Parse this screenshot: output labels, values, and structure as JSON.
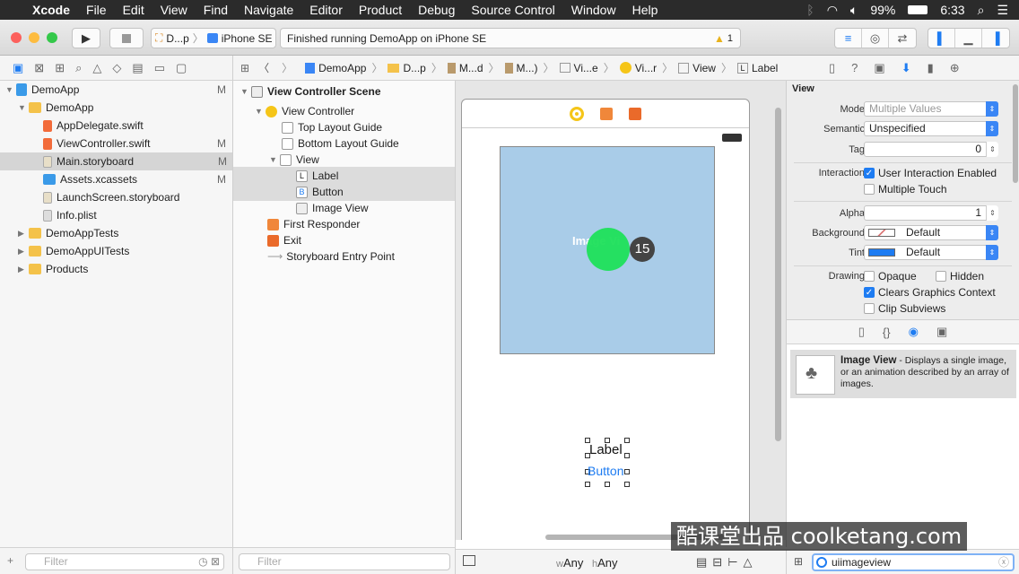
{
  "menubar": {
    "app_name": "Xcode",
    "items": [
      "File",
      "Edit",
      "View",
      "Find",
      "Navigate",
      "Editor",
      "Product",
      "Debug",
      "Source Control",
      "Window",
      "Help"
    ],
    "battery": "99%",
    "time": "6:33"
  },
  "toolbar": {
    "scheme_target": "D...p",
    "device": "iPhone SE",
    "activity_status": "Finished running DemoApp on iPhone SE",
    "warning_count": "1"
  },
  "navigator": {
    "items": [
      {
        "label": "DemoApp",
        "badge": "M"
      },
      {
        "label": "DemoApp",
        "badge": ""
      },
      {
        "label": "AppDelegate.swift",
        "badge": ""
      },
      {
        "label": "ViewController.swift",
        "badge": "M"
      },
      {
        "label": "Main.storyboard",
        "badge": "M"
      },
      {
        "label": "Assets.xcassets",
        "badge": "M"
      },
      {
        "label": "LaunchScreen.storyboard",
        "badge": ""
      },
      {
        "label": "Info.plist",
        "badge": ""
      },
      {
        "label": "DemoAppTests",
        "badge": ""
      },
      {
        "label": "DemoAppUITests",
        "badge": ""
      },
      {
        "label": "Products",
        "badge": ""
      }
    ],
    "filter_placeholder": "Filter"
  },
  "jumpbar": {
    "crumbs": [
      "DemoApp",
      "D...p",
      "M...d",
      "M...)",
      "Vi...e",
      "Vi...r",
      "View",
      "Label"
    ]
  },
  "outline": {
    "title": "View Controller Scene",
    "items": [
      "View Controller",
      "Top Layout Guide",
      "Bottom Layout Guide",
      "View",
      "Label",
      "Button",
      "Image View",
      "First Responder",
      "Exit",
      "Storyboard Entry Point"
    ],
    "filter_placeholder": "Filter"
  },
  "canvas": {
    "image_view_text": "Image Vi",
    "badge_number": "15",
    "label_text": "Label",
    "button_text": "Button",
    "size_w_prefix": "w",
    "size_w": "Any",
    "size_h_prefix": "h",
    "size_h": "Any"
  },
  "inspector": {
    "section": "View",
    "mode_label": "Mode",
    "mode_value": "Multiple Values",
    "semantic_label": "Semantic",
    "semantic_value": "Unspecified",
    "tag_label": "Tag",
    "tag_value": "0",
    "interaction_label": "Interaction",
    "user_interaction": "User Interaction Enabled",
    "multiple_touch": "Multiple Touch",
    "alpha_label": "Alpha",
    "alpha_value": "1",
    "background_label": "Background",
    "background_value": "Default",
    "tint_label": "Tint",
    "tint_value": "Default",
    "drawing_label": "Drawing",
    "opaque": "Opaque",
    "hidden": "Hidden",
    "clears_graphics": "Clears Graphics Context",
    "clip_subviews": "Clip Subviews"
  },
  "library": {
    "item_title": "Image View",
    "item_desc": " - Displays a single image, or an animation described by an array of images.",
    "search_value": "uiimageview"
  },
  "watermark": "酷课堂出品 coolketang.com",
  "colors": {
    "accent": "#1e7cf2",
    "image_view_bg": "#a9cce8",
    "green_circle": "#1ee05a"
  }
}
